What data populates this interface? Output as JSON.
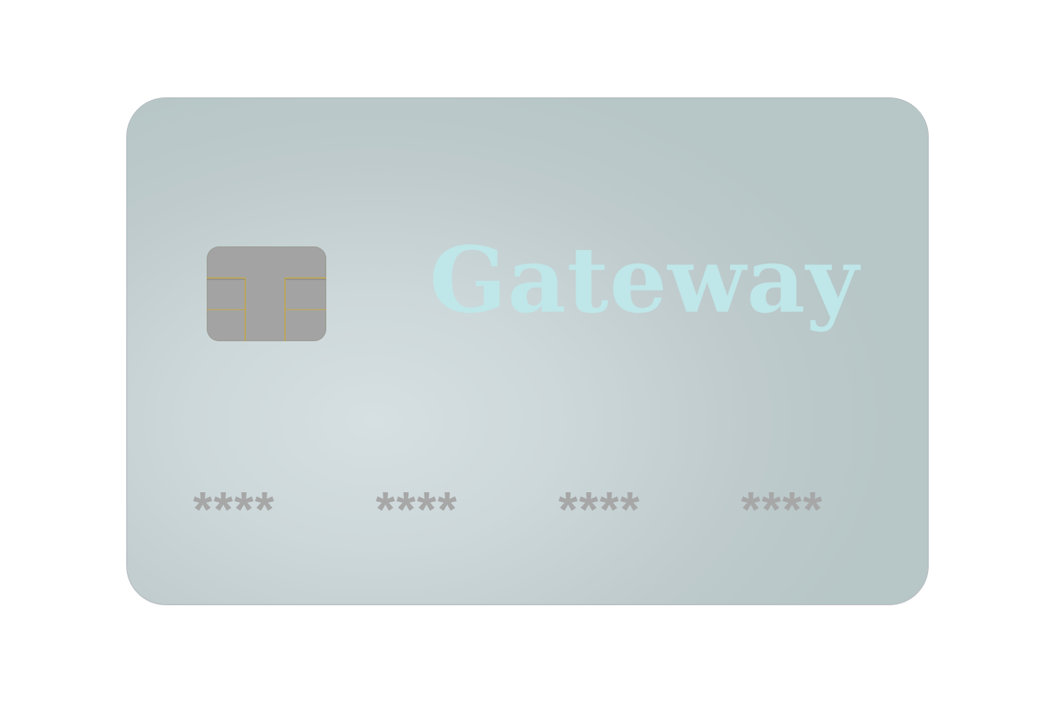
{
  "card": {
    "brand": "Gateway",
    "chip_icon": "emv-chip-icon",
    "number_groups": [
      "****",
      "****",
      "****",
      "****"
    ],
    "colors": {
      "card_surface": "#c9d4d6",
      "brand_text": "#bfe6e8",
      "chip": "#a3a3a3",
      "chip_contact_lines": "#c8a83c",
      "number_text": "#a7a7a7"
    }
  }
}
